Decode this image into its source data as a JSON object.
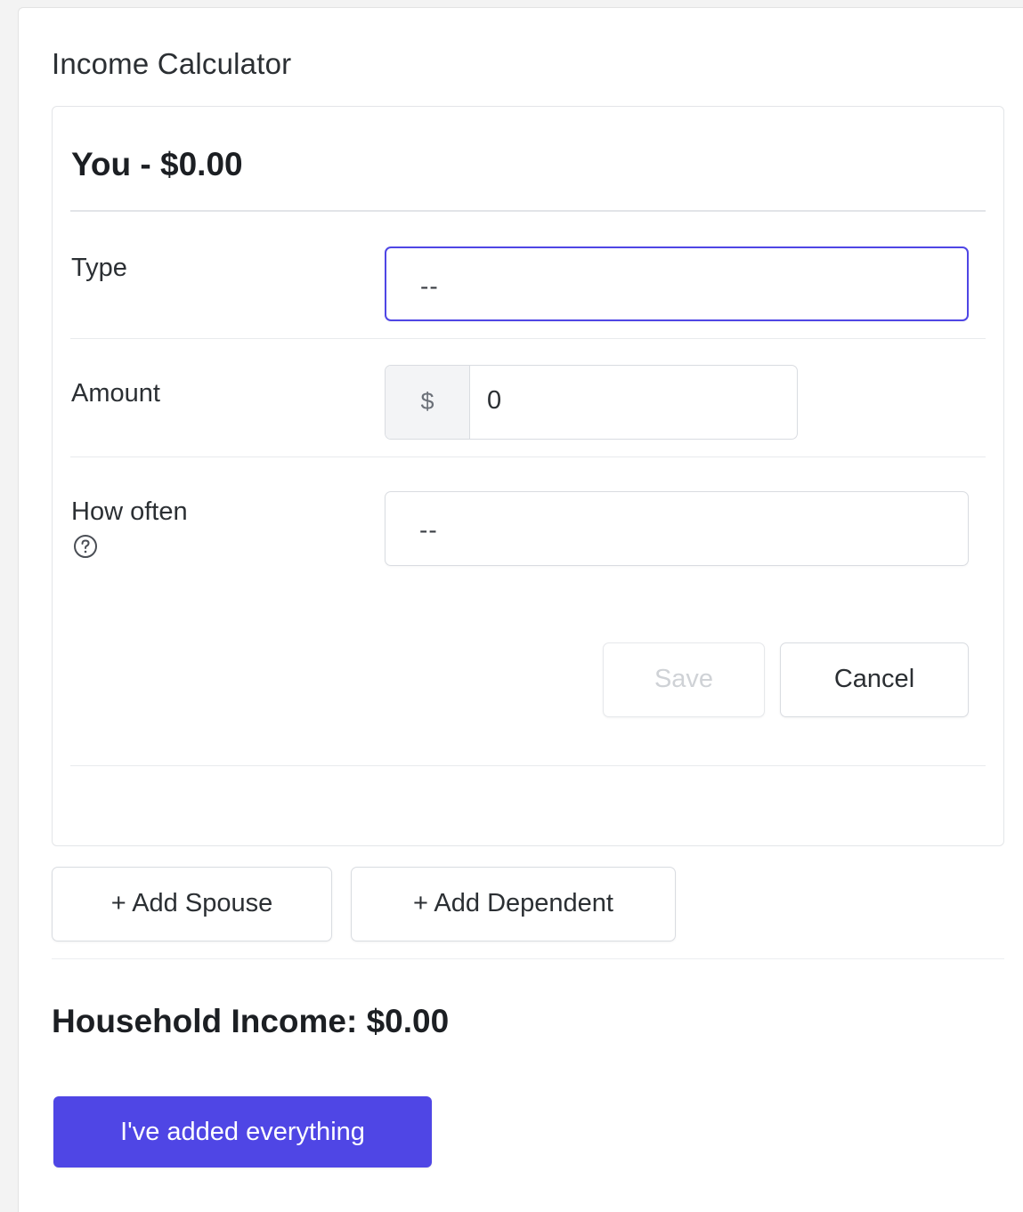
{
  "calculator": {
    "title": "Income Calculator"
  },
  "person_card": {
    "header": "You - $0.00",
    "fields": {
      "type": {
        "label": "Type",
        "value": "--"
      },
      "amount": {
        "label": "Amount",
        "prefix": "$",
        "value": "0"
      },
      "how_often": {
        "label": "How often",
        "value": "--",
        "help_icon": "question-circle-icon"
      }
    },
    "actions": {
      "save_label": "Save",
      "cancel_label": "Cancel"
    }
  },
  "add_buttons": {
    "spouse_label": "+ Add Spouse",
    "dependent_label": "+ Add Dependent"
  },
  "summary": {
    "household_income": "Household Income: $0.00"
  },
  "primary_action": {
    "label": "I've added everything"
  },
  "colors": {
    "accent": "#4f46e5",
    "border": "#d9dce1",
    "text": "#1f2328"
  }
}
